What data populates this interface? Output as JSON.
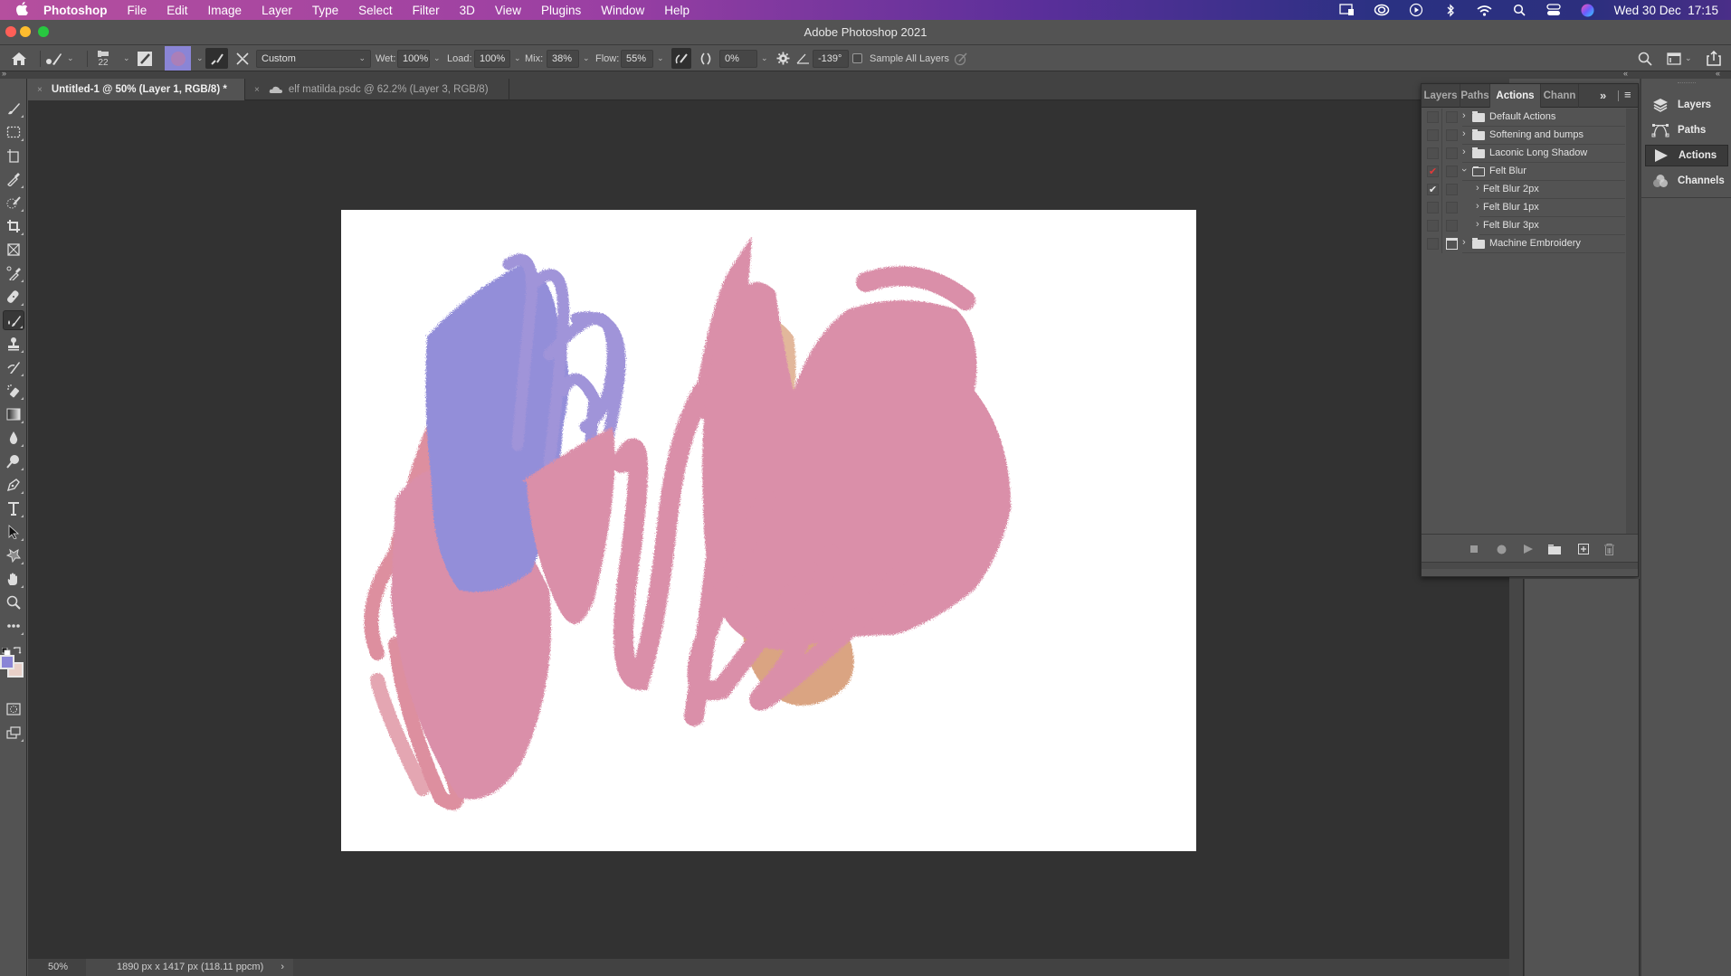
{
  "menubar": {
    "apple": "",
    "app_name": "Photoshop",
    "items": [
      "File",
      "Edit",
      "Image",
      "Layer",
      "Type",
      "Select",
      "Filter",
      "3D",
      "View",
      "Plugins",
      "Window",
      "Help"
    ],
    "status_icons": [
      "display-icon",
      "creative-cloud-icon",
      "play-circle-icon",
      "bluetooth-icon",
      "wifi-icon",
      "spotlight-search-icon",
      "control-center-icon",
      "siri-icon"
    ],
    "clock": "Wed 30 Dec  17:15"
  },
  "window": {
    "title": "Adobe Photoshop 2021",
    "traffic_colors": {
      "close": "#ff5f57",
      "minimize": "#febc2e",
      "zoom": "#28c840"
    }
  },
  "options_bar": {
    "brush_size": "22",
    "preset_label": "Custom",
    "wet_label": "Wet:",
    "wet_value": "100%",
    "load_label": "Load:",
    "load_value": "100%",
    "mix_label": "Mix:",
    "mix_value": "38%",
    "flow_label": "Flow:",
    "flow_value": "55%",
    "smoothing_value": "0%",
    "angle_value": "-139°",
    "sample_all_layers_label": "Sample All Layers",
    "sample_all_layers_checked": false,
    "brush_color": "#8a85d6"
  },
  "tabs": [
    {
      "close": "×",
      "label": "Untitled-1 @ 50% (Layer 1, RGB/8) *",
      "active": true
    },
    {
      "close": "×",
      "label": "elf matilda.psdc @ 62.2% (Layer 3, RGB/8)",
      "active": false,
      "cloud": true
    }
  ],
  "toolbar": {
    "tools": [
      "brush-tool",
      "marquee-tool",
      "artboard-tool",
      "eyedropper-tool",
      "quick-selection-tool",
      "crop-tool",
      "frame-tool",
      "color-sampler-tool",
      "healing-brush-tool",
      "mixer-brush-tool",
      "clone-stamp-tool",
      "history-brush-tool",
      "magic-eraser-tool",
      "gradient-tool",
      "blur-tool",
      "dodge-tool",
      "pen-tool",
      "type-tool",
      "path-selection-tool",
      "custom-shape-tool",
      "hand-tool",
      "zoom-tool",
      "more-tools"
    ],
    "active_tool": "mixer-brush-tool",
    "foreground_color": "#8a85d6",
    "background_color": "#e8d0c8"
  },
  "status_bar": {
    "zoom": "50%",
    "doc_info": "1890 px x 1417 px (118.11 ppcm)",
    "chevron": "›"
  },
  "actions_panel": {
    "tabs": [
      "Layers",
      "Paths",
      "Actions",
      "Chann"
    ],
    "active_tab": "Actions",
    "overflow": "»",
    "menu": "≡",
    "rows": [
      {
        "label": "Default Actions",
        "type": "set",
        "expanded": false,
        "check": "",
        "dialog": false
      },
      {
        "label": "Softening and bumps",
        "type": "set",
        "expanded": false,
        "check": "",
        "dialog": false
      },
      {
        "label": "Laconic Long Shadow",
        "type": "set",
        "expanded": false,
        "check": "",
        "dialog": false
      },
      {
        "label": "Felt Blur",
        "type": "set",
        "expanded": true,
        "check": "✔",
        "check_color": "#e03a3a",
        "dialog": false
      },
      {
        "label": "Felt Blur 2px",
        "type": "action",
        "expanded": false,
        "check": "✔",
        "check_color": "#e8e8e8",
        "dialog": false
      },
      {
        "label": "Felt Blur 1px",
        "type": "action",
        "expanded": false,
        "check": "",
        "dialog": false
      },
      {
        "label": "Felt Blur 3px",
        "type": "action",
        "expanded": false,
        "check": "",
        "dialog": false
      },
      {
        "label": "Machine Embroidery",
        "type": "set",
        "expanded": false,
        "check": "",
        "dialog": true
      }
    ],
    "footer_buttons": [
      "stop-icon",
      "record-icon",
      "play-icon",
      "new-set-icon",
      "new-action-icon",
      "delete-icon"
    ]
  },
  "dock": {
    "items": [
      {
        "label": "Layers",
        "icon": "layers-icon"
      },
      {
        "label": "Paths",
        "icon": "paths-icon"
      },
      {
        "label": "Actions",
        "icon": "actions-icon",
        "active": true
      },
      {
        "label": "Channels",
        "icon": "channels-icon"
      }
    ]
  },
  "canvas": {
    "background": "#ffffff",
    "paint_colors": {
      "lavender": "#8e88d8",
      "pink": "#d98aa5",
      "rose": "#dc8a9a",
      "peach": "#d9a07c"
    }
  }
}
